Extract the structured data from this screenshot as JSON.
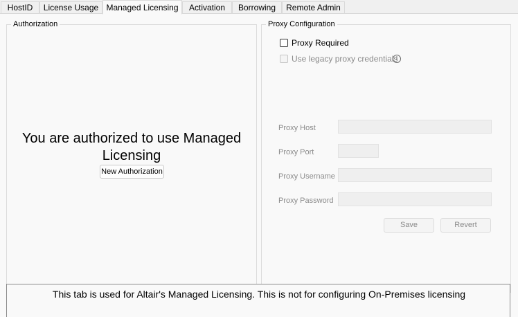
{
  "tabs": [
    {
      "label": "HostID"
    },
    {
      "label": "License Usage"
    },
    {
      "label": "Managed Licensing"
    },
    {
      "label": "Activation"
    },
    {
      "label": "Borrowing"
    },
    {
      "label": "Remote Admin"
    }
  ],
  "active_tab": "Managed Licensing",
  "authorization": {
    "title": "Authorization",
    "message": "You are authorized to use Managed Licensing",
    "new_auth_button": "New Authorization"
  },
  "proxy": {
    "title": "Proxy Configuration",
    "proxy_required_label": "Proxy Required",
    "proxy_required_checked": false,
    "legacy_label": "Use legacy proxy credentials",
    "legacy_checked": false,
    "legacy_enabled": false,
    "info_icon": "info-icon",
    "host_label": "Proxy Host",
    "host_value": "",
    "port_label": "Proxy Port",
    "port_value": "",
    "username_label": "Proxy Username",
    "username_value": "",
    "password_label": "Proxy Password",
    "password_value": "",
    "save_button": "Save",
    "revert_button": "Revert"
  },
  "footer": {
    "text": "This tab is used for Altair's Managed Licensing.  This is not for configuring On-Premises licensing"
  }
}
